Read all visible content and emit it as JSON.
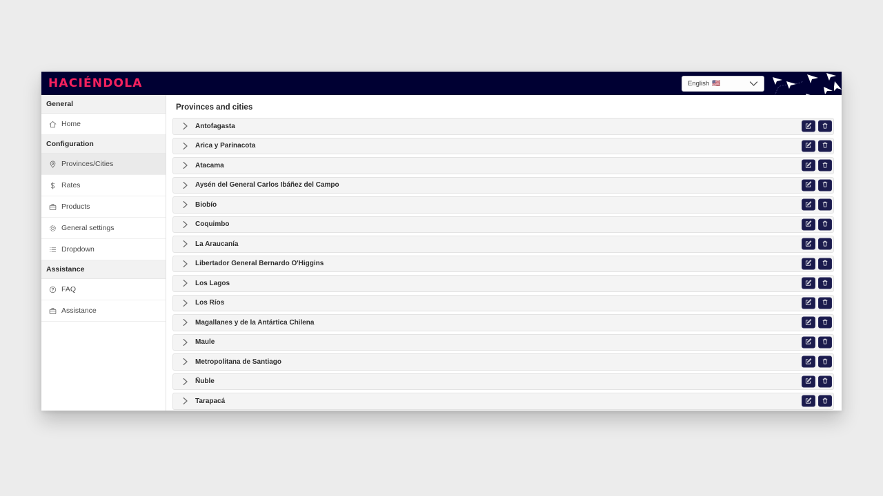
{
  "brand": {
    "logo_text": "HACIÉNDOLA",
    "logo_color": "#f4215e",
    "header_bg": "#000033"
  },
  "header": {
    "language": {
      "selected": "English",
      "flag": "🇺🇸",
      "chevron_icon": "chevron-down-icon"
    }
  },
  "sidebar": {
    "sections": [
      {
        "title": "General",
        "items": [
          {
            "label": "Home",
            "icon": "home-icon",
            "active": false
          }
        ]
      },
      {
        "title": "Configuration",
        "items": [
          {
            "label": "Provinces/Cities",
            "icon": "map-pin-icon",
            "active": true
          },
          {
            "label": "Rates",
            "icon": "dollar-icon",
            "active": false
          },
          {
            "label": "Products",
            "icon": "briefcase-icon",
            "active": false
          },
          {
            "label": "General settings",
            "icon": "gear-icon",
            "active": false
          },
          {
            "label": "Dropdown",
            "icon": "list-icon",
            "active": false
          }
        ]
      },
      {
        "title": "Assistance",
        "items": [
          {
            "label": "FAQ",
            "icon": "question-circle-icon",
            "active": false
          },
          {
            "label": "Assistance",
            "icon": "briefcase-icon",
            "active": false
          }
        ]
      }
    ]
  },
  "main": {
    "title": "Provinces and cities",
    "row_icons": {
      "expand": "chevron-right-icon",
      "edit": "edit-square-icon",
      "delete": "trash-icon"
    },
    "rows": [
      {
        "name": "Antofagasta"
      },
      {
        "name": "Arica y Parinacota"
      },
      {
        "name": "Atacama"
      },
      {
        "name": "Aysén del General Carlos Ibáñez del Campo"
      },
      {
        "name": "Biobío"
      },
      {
        "name": "Coquimbo"
      },
      {
        "name": "La Araucanía"
      },
      {
        "name": "Libertador General Bernardo O'Higgins"
      },
      {
        "name": "Los Lagos"
      },
      {
        "name": "Los Ríos"
      },
      {
        "name": "Magallanes y de la Antártica Chilena"
      },
      {
        "name": "Maule"
      },
      {
        "name": "Metropolitana de Santiago"
      },
      {
        "name": "Ñuble"
      },
      {
        "name": "Tarapacá"
      }
    ]
  }
}
